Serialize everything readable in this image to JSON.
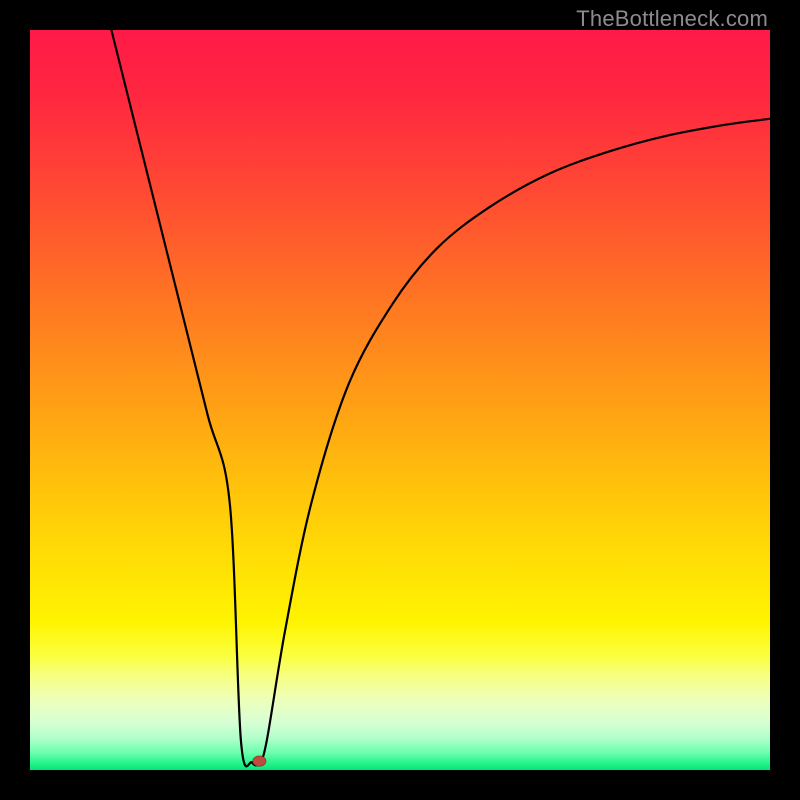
{
  "watermark": "TheBottleneck.com",
  "chart_data": {
    "type": "line",
    "title": "",
    "xlabel": "",
    "ylabel": "",
    "xlim": [
      0,
      100
    ],
    "ylim": [
      0,
      100
    ],
    "grid": false,
    "legend": false,
    "series": [
      {
        "name": "bottleneck-curve",
        "x": [
          11,
          15,
          20,
          24,
          27,
          28.5,
          30,
          31,
          32,
          34.5,
          38,
          43,
          49,
          55,
          62,
          70,
          78,
          86,
          94,
          100
        ],
        "y": [
          100,
          84,
          64,
          48,
          36,
          4,
          1,
          1,
          4,
          19,
          36,
          52,
          63,
          70.5,
          76,
          80.5,
          83.5,
          85.7,
          87.2,
          88
        ]
      }
    ],
    "markers": [
      {
        "name": "sweet-spot",
        "x": 31,
        "y": 1.2,
        "color": "#c14a3e"
      }
    ],
    "background_gradient_stops": [
      {
        "pos": 0.0,
        "color": "#ff1a48"
      },
      {
        "pos": 0.09,
        "color": "#ff2740"
      },
      {
        "pos": 0.22,
        "color": "#ff4a33"
      },
      {
        "pos": 0.36,
        "color": "#ff7423"
      },
      {
        "pos": 0.5,
        "color": "#ff9e15"
      },
      {
        "pos": 0.63,
        "color": "#ffc60a"
      },
      {
        "pos": 0.73,
        "color": "#ffe205"
      },
      {
        "pos": 0.8,
        "color": "#fff400"
      },
      {
        "pos": 0.845,
        "color": "#fbff3e"
      },
      {
        "pos": 0.875,
        "color": "#f6ff86"
      },
      {
        "pos": 0.905,
        "color": "#edffba"
      },
      {
        "pos": 0.935,
        "color": "#d8ffd4"
      },
      {
        "pos": 0.958,
        "color": "#aeffc9"
      },
      {
        "pos": 0.976,
        "color": "#6effaf"
      },
      {
        "pos": 0.99,
        "color": "#29f58e"
      },
      {
        "pos": 1.0,
        "color": "#03e675"
      }
    ]
  }
}
